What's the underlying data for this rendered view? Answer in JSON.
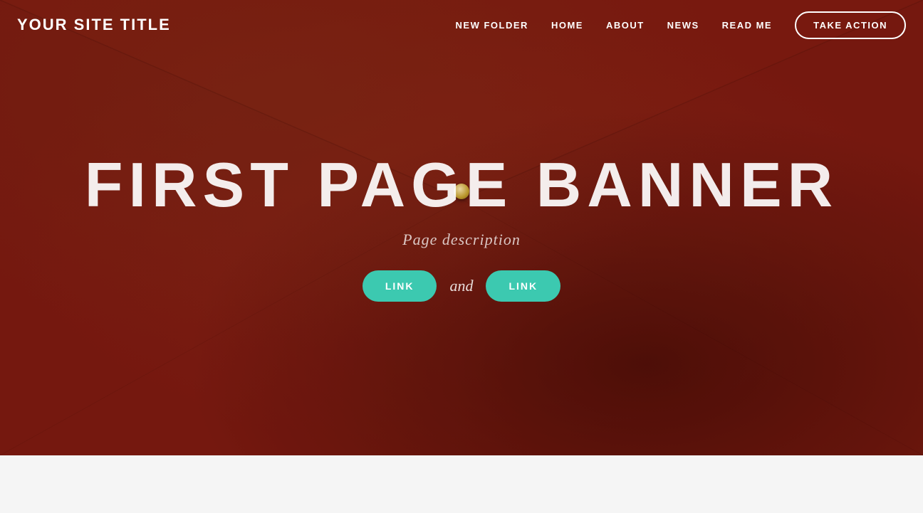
{
  "nav": {
    "site_title": "YOUR SITE TITLE",
    "links": [
      {
        "label": "NEW FOLDER",
        "id": "new-folder"
      },
      {
        "label": "HOME",
        "id": "home"
      },
      {
        "label": "ABOUT",
        "id": "about"
      },
      {
        "label": "NEWS",
        "id": "news"
      },
      {
        "label": "READ ME",
        "id": "read-me"
      }
    ],
    "cta_label": "TAKE ACTION"
  },
  "hero": {
    "banner_title": "FIRST PAGE BANNER",
    "description": "Page description",
    "button1_label": "LINK",
    "and_text": "and",
    "button2_label": "LINK"
  },
  "colors": {
    "teal": "#3cc9b0",
    "dark_red": "#7a1a10",
    "white": "#ffffff"
  }
}
